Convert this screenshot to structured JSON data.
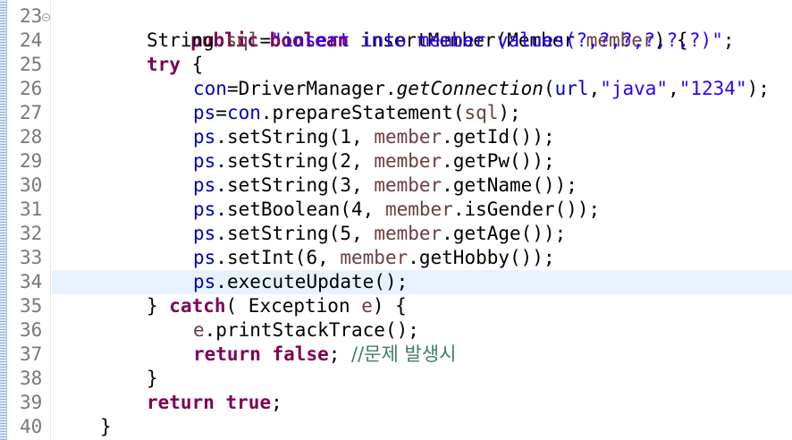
{
  "editor": {
    "colors": {
      "keyword": "#7f0055",
      "string": "#2a00ff",
      "field": "#0000c0",
      "local_var": "#6a3e3e",
      "comment": "#3f7f5f",
      "line_number": "#787878",
      "current_line_bg": "#e8f2fe"
    },
    "fold_icon": "collapse-icon",
    "lines": [
      {
        "num": "23",
        "tokens": [
          "public",
          "boolean",
          "insertMember(Member ",
          "member",
          ") {"
        ]
      },
      {
        "num": "24",
        "tokens": [
          "String ",
          "sql",
          "=",
          "\"insert into member values(?,?,?,?,?,?)\"",
          ";"
        ]
      },
      {
        "num": "25",
        "tokens": [
          "try",
          " {"
        ]
      },
      {
        "num": "26",
        "tokens": [
          "con",
          "=DriverManager.",
          "getConnection",
          "(",
          "url",
          ",",
          "\"java\"",
          ",",
          "\"1234\"",
          ");"
        ]
      },
      {
        "num": "27",
        "tokens": [
          "ps",
          "=",
          "con",
          ".prepareStatement(",
          "sql",
          ");"
        ]
      },
      {
        "num": "28",
        "tokens": [
          "ps",
          ".setString(1, ",
          "member",
          ".getId());"
        ]
      },
      {
        "num": "29",
        "tokens": [
          "ps",
          ".setString(2, ",
          "member",
          ".getPw());"
        ]
      },
      {
        "num": "30",
        "tokens": [
          "ps",
          ".setString(3, ",
          "member",
          ".getName());"
        ]
      },
      {
        "num": "31",
        "tokens": [
          "ps",
          ".setBoolean(4, ",
          "member",
          ".isGender());"
        ]
      },
      {
        "num": "32",
        "tokens": [
          "ps",
          ".setString(5, ",
          "member",
          ".getAge());"
        ]
      },
      {
        "num": "33",
        "tokens": [
          "ps",
          ".setInt(6, ",
          "member",
          ".getHobby());"
        ]
      },
      {
        "num": "34",
        "tokens": [
          "ps",
          ".executeUpdate();"
        ]
      },
      {
        "num": "35",
        "tokens": [
          "} ",
          "catch",
          "( Exception ",
          "e",
          ") {"
        ]
      },
      {
        "num": "36",
        "tokens": [
          "e",
          ".printStackTrace();"
        ]
      },
      {
        "num": "37",
        "tokens": [
          "return",
          " ",
          "false",
          "; ",
          "//문제 발생시"
        ]
      },
      {
        "num": "38",
        "tokens": [
          "}"
        ]
      },
      {
        "num": "39",
        "tokens": [
          "return",
          " ",
          "true",
          ";"
        ]
      },
      {
        "num": "40",
        "tokens": [
          "}"
        ]
      }
    ]
  }
}
